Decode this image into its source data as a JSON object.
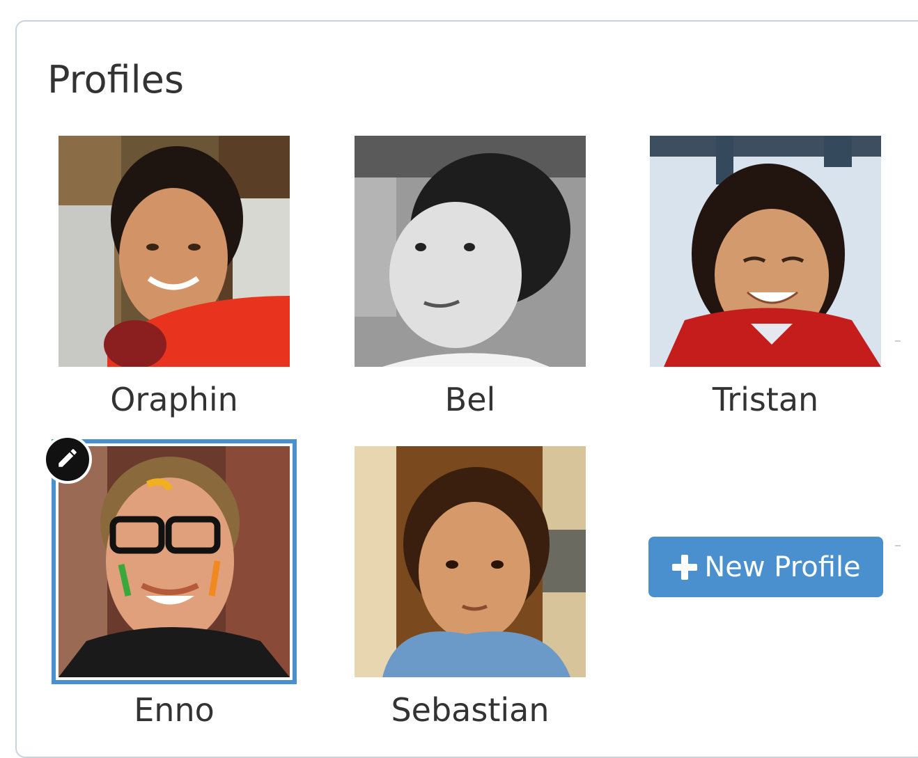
{
  "panel": {
    "title": "Profiles"
  },
  "profiles": [
    {
      "name": "Oraphin",
      "photo_icon": "woman-portrait-photo",
      "selected": false
    },
    {
      "name": "Bel",
      "photo_icon": "child-bw-portrait-photo",
      "selected": false
    },
    {
      "name": "Tristan",
      "photo_icon": "smiling-child-portrait-photo",
      "selected": false
    },
    {
      "name": "Enno",
      "photo_icon": "man-glasses-portrait-photo",
      "selected": true
    },
    {
      "name": "Sebastian",
      "photo_icon": "boy-portrait-photo",
      "selected": false
    }
  ],
  "actions": {
    "new_profile_label": "New Profile",
    "new_profile_icon": "plus-icon",
    "edit_icon": "pencil-icon"
  },
  "colors": {
    "accent": "#4a90cf",
    "text": "#333333",
    "border": "#c9d3dc",
    "badge": "#111111"
  }
}
